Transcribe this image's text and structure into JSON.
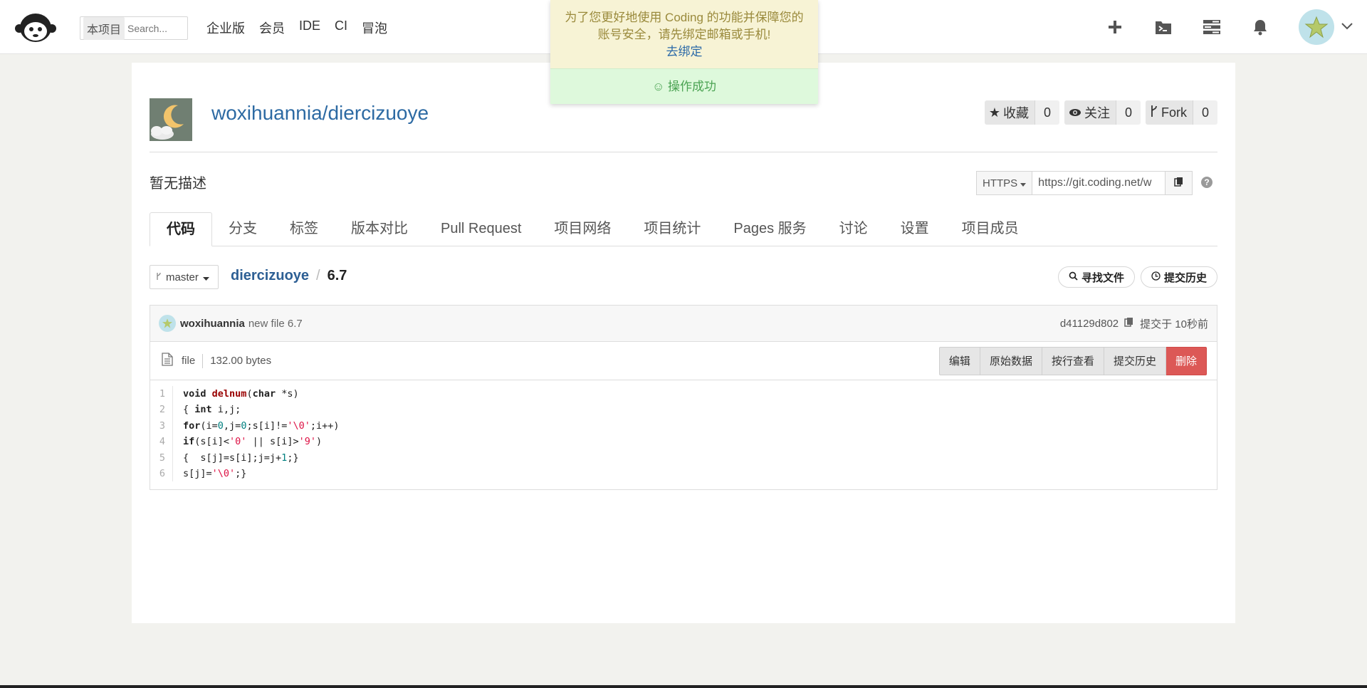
{
  "topbar": {
    "search_scope": "本项目",
    "search_placeholder": "Search...",
    "links": [
      "企业版",
      "会员",
      "IDE",
      "CI",
      "冒泡"
    ]
  },
  "toast": {
    "warning_line1": "为了您更好地使用 Coding 的功能并保障您的",
    "warning_line2": "账号安全，请先绑定邮箱或手机!",
    "bind_link": "去绑定",
    "success": "操作成功"
  },
  "repo": {
    "title": "woxihuannia/diercizuoye",
    "star_label": "收藏",
    "star_count": "0",
    "watch_label": "关注",
    "watch_count": "0",
    "fork_label": "Fork",
    "fork_count": "0",
    "description": "暂无描述",
    "protocol": "HTTPS",
    "clone_url": "https://git.coding.net/w"
  },
  "tabs": [
    "代码",
    "分支",
    "标签",
    "版本对比",
    "Pull Request",
    "项目网络",
    "项目统计",
    "Pages 服务",
    "讨论",
    "设置",
    "项目成员"
  ],
  "browser": {
    "branch": "master",
    "repo_crumb": "diercizuoye",
    "separator": "/",
    "file_crumb": "6.7",
    "find_file": "寻找文件",
    "history": "提交历史"
  },
  "commit": {
    "user": "woxihuannia",
    "message": "new file 6.7",
    "hash": "d41129d802",
    "time": "提交于 10秒前"
  },
  "file": {
    "type": "file",
    "size": "132.00 bytes",
    "actions": [
      "编辑",
      "原始数据",
      "按行查看",
      "提交历史",
      "删除"
    ]
  },
  "code_lines": [
    "void delnum(char *s)",
    "{ int i,j;",
    "for(i=0,j=0;s[i]!='\\0';i++)",
    "if(s[i]<'0' || s[i]>'9')",
    "{  s[j]=s[i];j=j+1;}",
    "s[j]='\\0';}"
  ],
  "colors": {
    "link": "#2d6aa3",
    "danger": "#dc5856",
    "success_text": "#4ba353",
    "warn_bg": "#f7f3d5"
  }
}
